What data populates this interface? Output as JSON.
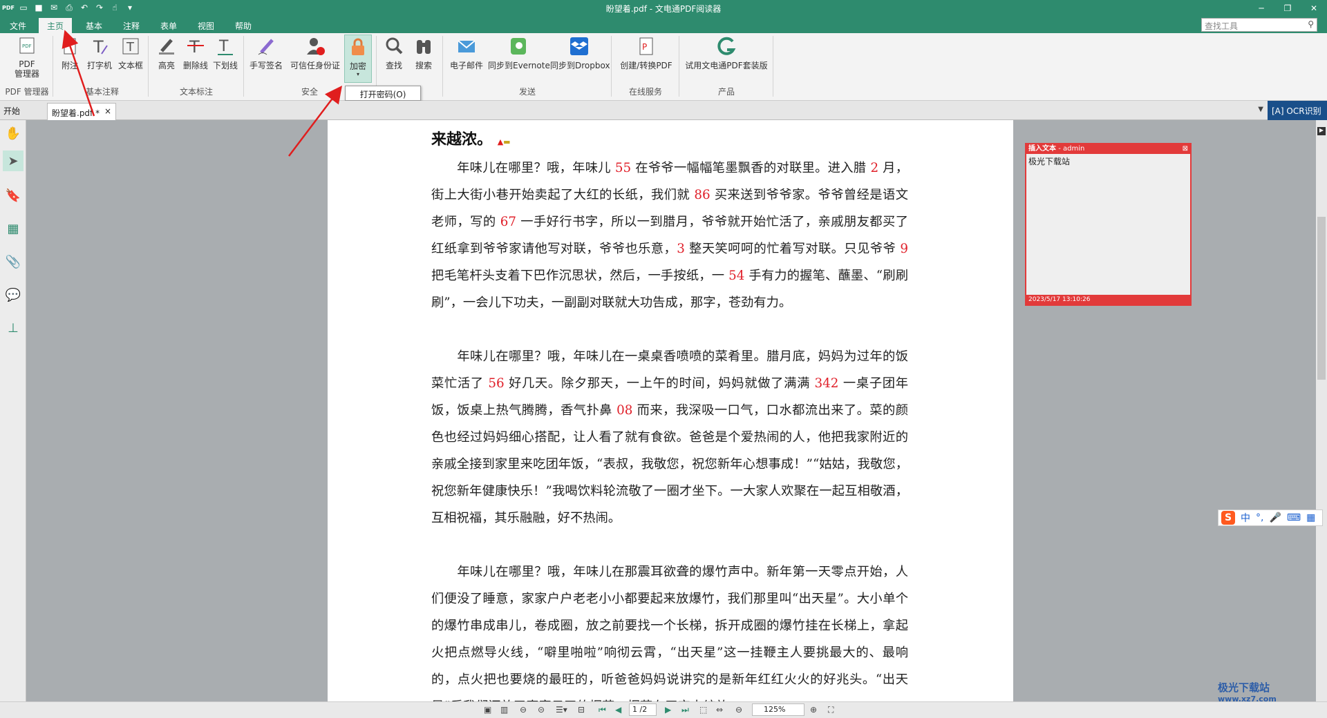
{
  "window": {
    "title": "盼望着.pdf - 文电通PDF阅读器"
  },
  "menu": {
    "items": [
      "文件",
      "主页",
      "基本",
      "注释",
      "表单",
      "视图",
      "帮助"
    ],
    "active": "主页"
  },
  "search_tools": {
    "placeholder": "查找工具"
  },
  "ribbon": {
    "pdf_manager": "PDF\n管理器",
    "annotate_attach": "附注",
    "typewriter": "打字机",
    "textbox": "文本框",
    "highlight": "高亮",
    "strikethrough": "删除线",
    "underline": "下划线",
    "handwrite_sign": "手写签名",
    "trusted_id": "可信任身份证",
    "encrypt": "加密",
    "find": "查找",
    "search": "搜索",
    "email": "电子邮件",
    "sync_evernote": "同步到Evernote",
    "sync_dropbox": "同步到Dropbox",
    "create_convert": "创建/转换PDF",
    "trial_suite": "试用文电通PDF套装版",
    "groups": {
      "pdf_manager": "PDF 管理器",
      "basic_annot": "基本注释",
      "text_markup": "文本标注",
      "security": "安全",
      "send": "发送",
      "online": "在线服务",
      "product": "产品"
    },
    "tooltip": "打开密码(O)"
  },
  "tabs": {
    "start": "开始",
    "doc": "盼望着.pdf *",
    "close": "×",
    "ocr": "OCR识别"
  },
  "document": {
    "heading": "来越浓。",
    "paragraphs": [
      [
        {
          "t": "　　年味儿在哪里？哦，年味儿 "
        },
        {
          "n": "55"
        },
        {
          "t": " 在爷爷一幅幅笔墨飘香的对联里。进入腊 "
        },
        {
          "n": "2"
        },
        {
          "t": " 月，街上大街小巷开始卖起了大红的长纸，我们就 "
        },
        {
          "n": "86"
        },
        {
          "t": " 买来送到爷爷家。爷爷曾经是语文老师，写的 "
        },
        {
          "n": "67"
        },
        {
          "t": " 一手好行书字，所以一到腊月，爷爷就开始忙活了，亲戚朋友都买了红纸拿到爷爷家请他写对联，爷爷也乐意，"
        },
        {
          "n": "3"
        },
        {
          "t": " 整天笑呵呵的忙着写对联。只见爷爷 "
        },
        {
          "n": "9"
        },
        {
          "t": " 把毛笔杆头支着下巴作沉思状，然后，一手按纸，一 "
        },
        {
          "n": "54"
        },
        {
          "t": " 手有力的握笔、蘸墨、“刷刷刷”，一会儿下功夫，一副副对联就大功告成，那字，苍劲有力。"
        }
      ],
      [
        {
          "t": "　　年味儿在哪里？哦，年味儿在一桌桌香喷喷的菜肴里。腊月底，妈妈为过年的饭菜忙活了 "
        },
        {
          "n": "56"
        },
        {
          "t": " 好几天。除夕那天，一上午的时间，妈妈就做了满满 "
        },
        {
          "n": "342"
        },
        {
          "t": " 一桌子团年饭，饭桌上热气腾腾，香气扑鼻 "
        },
        {
          "n": "08"
        },
        {
          "t": " 而来，我深吸一口气，口水都流出来了。菜的颜色也经过妈妈细心搭配，让人看了就有食欲。爸爸是个爱热闹的人，他把我家附近的亲戚全接到家里来吃团年饭，“表叔，我敬您，祝您新年心想事成！”“姑姑，我敬您，祝您新年健康快乐！”我喝饮料轮流敬了一圈才坐下。一大家人欢聚在一起互相敬酒，互相祝福，其乐融融，好不热闹。"
        }
      ],
      [
        {
          "t": "　　年味儿在哪里？哦，年味儿在那震耳欲聋的爆竹声中。新年第一天零点开始，人们便没了睡意，家家户户老老小小都要起来放爆竹，我们那里叫“出天星”。大小单个的爆竹串成串儿，卷成圈，放之前要找一个长梯，拆开成圈的爆竹挂在长梯上，拿起火把点燃导火线，“噼里啪啦”响彻云霄，“出天星”这一挂鞭主人要挑最大的、最响的，点火把也要烧的最旺的，听爸爸妈妈说讲究的是新年红红火火的好兆头。“出天星”后我们还放了直窜云天的烟花，烟花在天空中绽放"
        }
      ]
    ]
  },
  "sticky_note": {
    "title": "插入文本",
    "author": "- admin",
    "body": "极光下载站",
    "timestamp": "2023/5/17 13:10:26"
  },
  "status": {
    "page": "1 /2",
    "zoom": "125%"
  },
  "ime": {
    "label": "中"
  },
  "watermark": {
    "name": "极光下载站",
    "url": "www.xz7.com"
  },
  "colors": {
    "brand": "#2e8b6e",
    "number_red": "#e0202a",
    "note_red": "#e23a3a",
    "ocr_blue": "#1a4f8a",
    "arrow_red": "#e01e1e"
  }
}
